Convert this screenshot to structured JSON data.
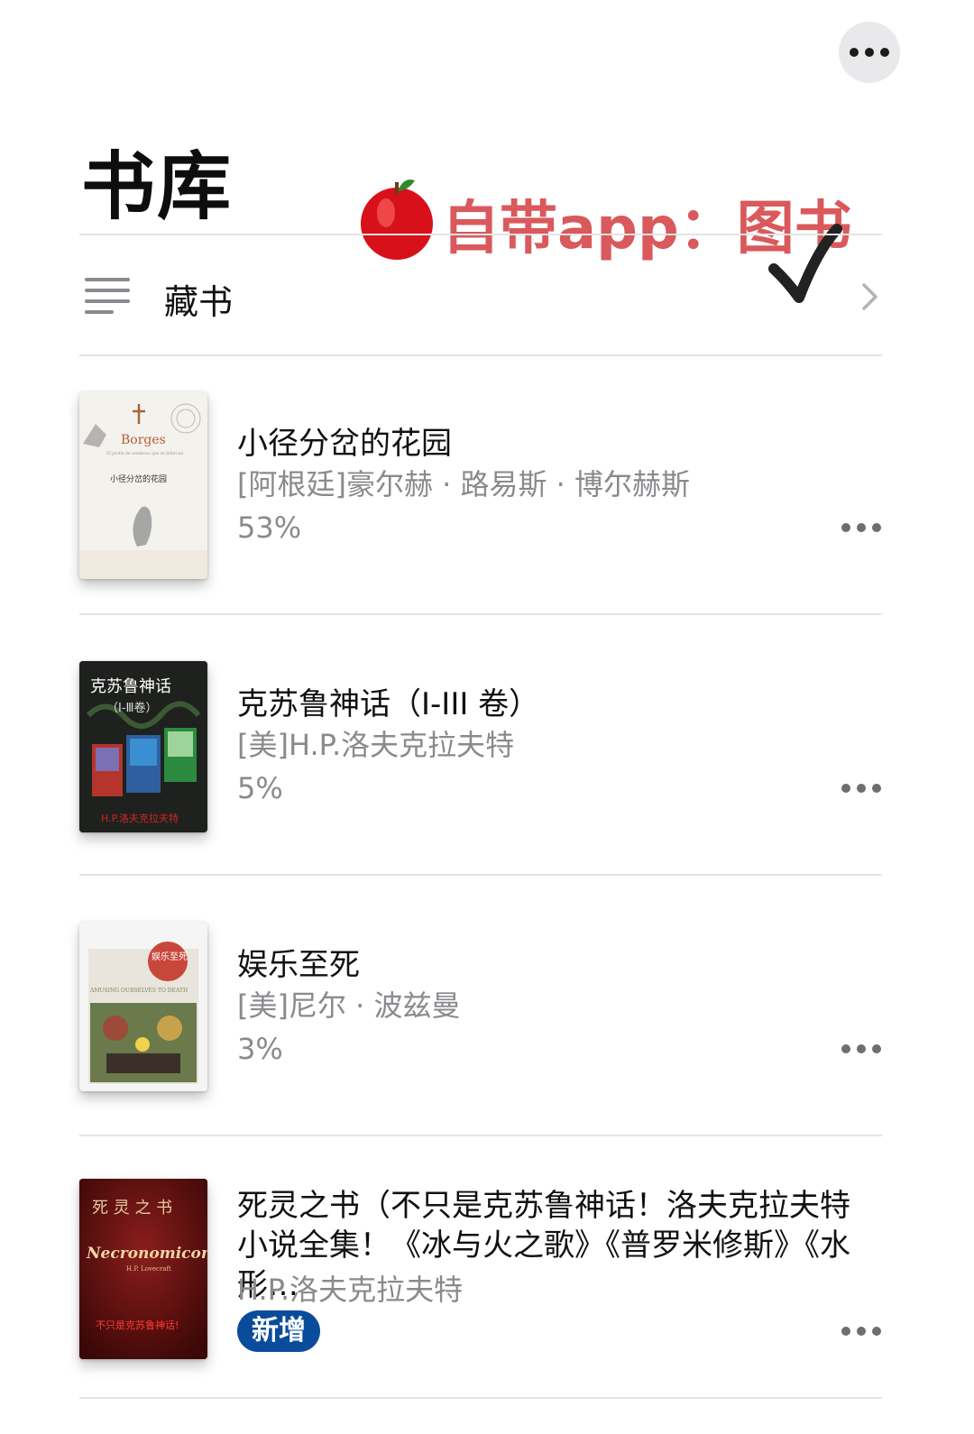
{
  "header": {
    "title": "书库",
    "more_icon": "ellipsis-icon"
  },
  "sticker": {
    "text": "自带app：图书",
    "emoji": "🍎",
    "check": "✓"
  },
  "collection": {
    "label": "藏书",
    "icon": "list-icon",
    "chevron": "chevron-right-icon"
  },
  "books": [
    {
      "title": "小径分岔的花园",
      "author": "[阿根廷]豪尔赫 · 路易斯 · 博尔赫斯",
      "progress": "53%",
      "cover": {
        "brand": "Borges",
        "subtitle": "El jardín de senderos que se bifurcan",
        "title_cn": "小径分岔的花园"
      }
    },
    {
      "title": "克苏鲁神话（I-III 卷）",
      "author": "[美]H.P.洛夫克拉夫特",
      "progress": "5%",
      "cover": {
        "title_cn": "克苏鲁神话",
        "volume": "（I-Ⅲ卷）",
        "author_cn": "H.P.洛夫克拉夫特"
      }
    },
    {
      "title": "娱乐至死",
      "author": "[美]尼尔 · 波兹曼",
      "progress": "3%",
      "cover": {
        "badge_cn": "娱乐至死",
        "english": "AMUSING OURSELVES TO DEATH"
      }
    },
    {
      "title": "死灵之书（不只是克苏鲁神话！洛夫克拉夫特小说全集！《冰与火之歌》《普罗米修斯》《水形…",
      "author": "H.P.洛夫克拉夫特",
      "badge": "新增",
      "cover": {
        "title_cn": "死 灵 之 书",
        "english": "Necronomicon",
        "author_en": "H.P. Lovecraft",
        "tagline": "不只是克苏鲁神话!"
      }
    }
  ],
  "colors": {
    "accent_badge": "#0a4c9c",
    "secondary_text": "#8a8a8e",
    "sticker_text": "#d9595c"
  }
}
